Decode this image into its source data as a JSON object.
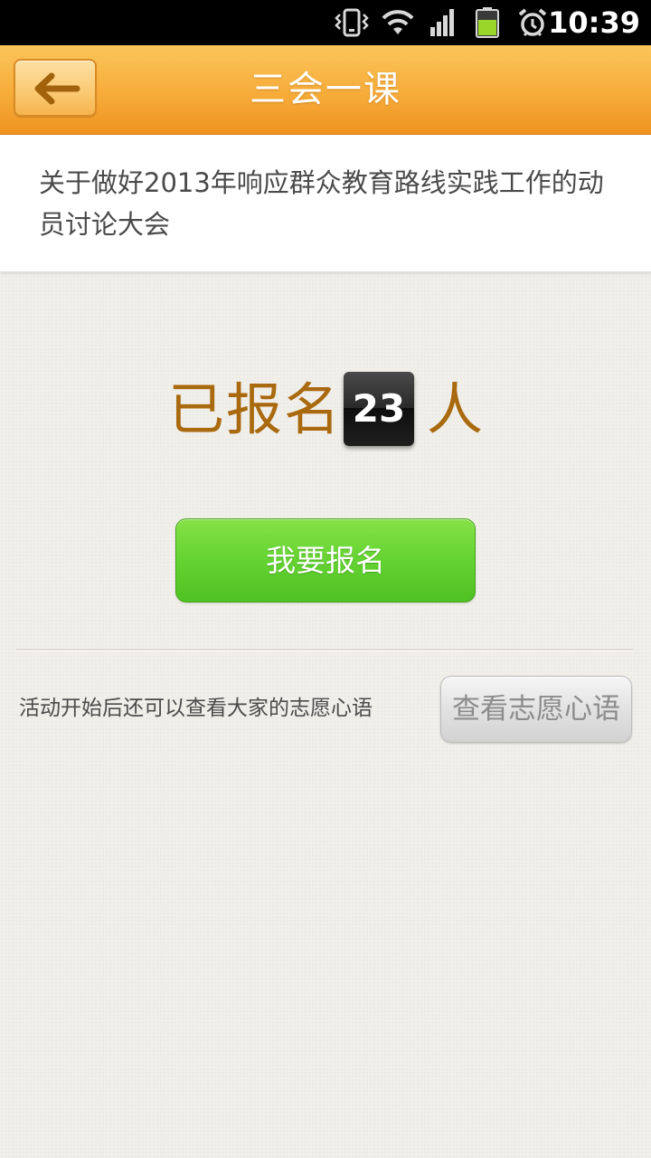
{
  "status_bar": {
    "time": "10:39",
    "icons": [
      "vibrate-icon",
      "wifi-icon",
      "signal-icon",
      "battery-icon",
      "alarm-icon"
    ]
  },
  "header": {
    "title": "三会一课",
    "back_icon": "back-arrow-icon"
  },
  "activity": {
    "title": "关于做好2013年响应群众教育路线实践工作的动员讨论大会"
  },
  "registration": {
    "prefix": "已报名",
    "count": "23",
    "suffix": "人",
    "register_label": "我要报名"
  },
  "footer": {
    "hint": "活动开始后还可以查看大家的志愿心语",
    "view_label": "查看志愿心语"
  },
  "colors": {
    "header_orange": "#f7ac3a",
    "count_text": "#a9690e",
    "register_green": "#64d332",
    "view_gray": "#e2e2e2"
  }
}
